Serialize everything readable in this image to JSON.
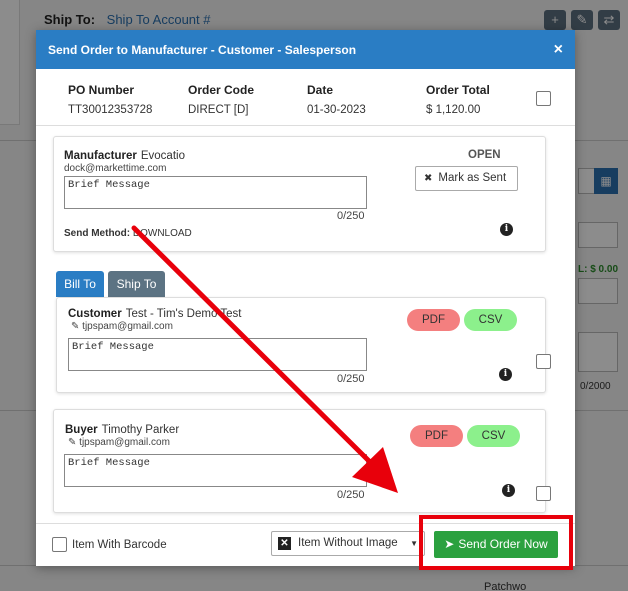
{
  "background": {
    "ship_to_label": "Ship To:",
    "ship_to_account": "Ship To Account #",
    "icons": [
      "plus-icon",
      "pencil-icon",
      "swap-icon"
    ],
    "total_label": "L: $ 0.00",
    "char_count": "0/2000",
    "row_label": "Patchwo"
  },
  "modal": {
    "title": "Send Order to Manufacturer - Customer - Salesperson",
    "close_glyph": "×",
    "summary": {
      "po_number_label": "PO Number",
      "po_number": "TT30012353728",
      "order_code_label": "Order Code",
      "order_code": "DIRECT [D]",
      "date_label": "Date",
      "date": "01-30-2023",
      "order_total_label": "Order Total",
      "order_total": "$ 1,120.00"
    },
    "manufacturer": {
      "label": "Manufacturer",
      "name": "Evocatio",
      "email": "dock@markettime.com",
      "status": "OPEN",
      "mark_sent_label": "Mark as Sent",
      "message_placeholder": "Brief Message",
      "char_count": "0/250",
      "send_method_label": "Send Method:",
      "send_method": "DOWNLOAD"
    },
    "tabs": [
      {
        "label": "Bill To",
        "active": true
      },
      {
        "label": "Ship To",
        "active": false
      }
    ],
    "customer": {
      "label": "Customer",
      "name": "Test - Tim's Demo Test",
      "email": "tjpspam@gmail.com",
      "pdf_label": "PDF",
      "csv_label": "CSV",
      "message_placeholder": "Brief Message",
      "char_count": "0/250"
    },
    "buyer": {
      "label": "Buyer",
      "name": "Timothy Parker",
      "email": "tjpspam@gmail.com",
      "pdf_label": "PDF",
      "csv_label": "CSV",
      "message_placeholder": "Brief Message",
      "char_count": "0/250"
    },
    "footer": {
      "item_with_barcode_label": "Item With Barcode",
      "item_without_image_label": "Item Without Image",
      "send_button_label": "Send Order Now"
    }
  },
  "colors": {
    "header_blue": "#2a7dc4",
    "send_green": "#2ba13f",
    "pdf_red": "#f47f7f",
    "csv_green": "#8cf08c",
    "highlight_red": "#e8000b"
  }
}
